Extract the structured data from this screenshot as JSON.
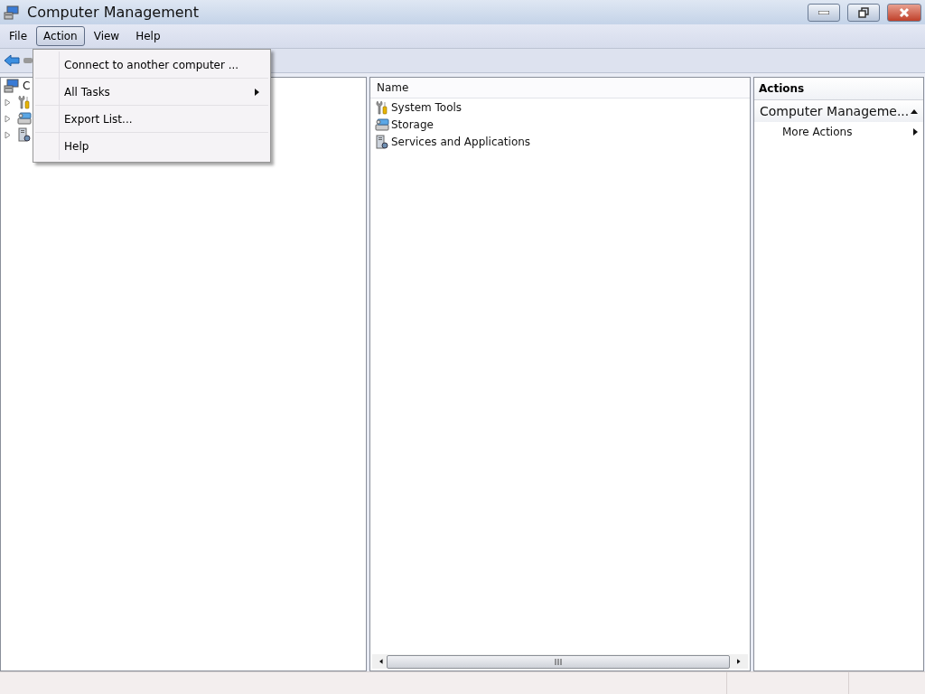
{
  "window": {
    "title": "Computer Management"
  },
  "menu_bar": [
    {
      "label": "File",
      "selected": false
    },
    {
      "label": "Action",
      "selected": true
    },
    {
      "label": "View",
      "selected": false
    },
    {
      "label": "Help",
      "selected": false
    }
  ],
  "action_menu": [
    {
      "label": "Connect to another computer ...",
      "kind": "item"
    },
    {
      "label": "All Tasks",
      "kind": "submenu"
    },
    {
      "label": "Export List...",
      "kind": "item"
    },
    {
      "label": "Help",
      "kind": "item"
    }
  ],
  "tree": {
    "label": "C",
    "children": [
      {
        "kind": "tools",
        "expanded": false
      },
      {
        "kind": "storage",
        "expanded": false
      },
      {
        "kind": "services",
        "expanded": false
      }
    ]
  },
  "list": {
    "columns": [
      "Name"
    ],
    "rows": [
      {
        "name": "System Tools",
        "kind": "tools"
      },
      {
        "name": "Storage",
        "kind": "storage"
      },
      {
        "name": "Services and Applications",
        "kind": "services"
      }
    ]
  },
  "actions": {
    "header": "Actions",
    "group": {
      "title": "Computer Manageme...",
      "expanded": true
    },
    "items": [
      {
        "label": "More Actions",
        "kind": "submenu"
      }
    ]
  }
}
